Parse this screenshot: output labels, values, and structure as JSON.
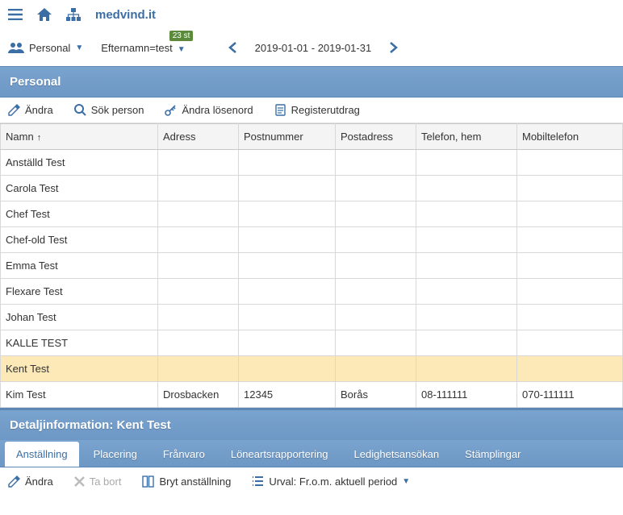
{
  "brand": "medvind.it",
  "toolbar": {
    "personal_label": "Personal",
    "filter_label": "Efternamn=test",
    "badge": "23 st",
    "date_range": "2019-01-01 - 2019-01-31"
  },
  "section_title": "Personal",
  "actions": {
    "edit": "Ändra",
    "search_person": "Sök person",
    "change_password": "Ändra lösenord",
    "register_extract": "Registerutdrag"
  },
  "columns": [
    "Namn",
    "Adress",
    "Postnummer",
    "Postadress",
    "Telefon, hem",
    "Mobiltelefon"
  ],
  "sort_indicator": "↑",
  "rows": [
    {
      "name": "Anställd Test",
      "adress": "",
      "postnr": "",
      "postadr": "",
      "tel": "",
      "mobil": "",
      "selected": false
    },
    {
      "name": "Carola Test",
      "adress": "",
      "postnr": "",
      "postadr": "",
      "tel": "",
      "mobil": "",
      "selected": false
    },
    {
      "name": "Chef Test",
      "adress": "",
      "postnr": "",
      "postadr": "",
      "tel": "",
      "mobil": "",
      "selected": false
    },
    {
      "name": "Chef-old Test",
      "adress": "",
      "postnr": "",
      "postadr": "",
      "tel": "",
      "mobil": "",
      "selected": false
    },
    {
      "name": "Emma Test",
      "adress": "",
      "postnr": "",
      "postadr": "",
      "tel": "",
      "mobil": "",
      "selected": false
    },
    {
      "name": "Flexare Test",
      "adress": "",
      "postnr": "",
      "postadr": "",
      "tel": "",
      "mobil": "",
      "selected": false
    },
    {
      "name": "Johan Test",
      "adress": "",
      "postnr": "",
      "postadr": "",
      "tel": "",
      "mobil": "",
      "selected": false
    },
    {
      "name": "KALLE TEST",
      "adress": "",
      "postnr": "",
      "postadr": "",
      "tel": "",
      "mobil": "",
      "selected": false
    },
    {
      "name": "Kent Test",
      "adress": "",
      "postnr": "",
      "postadr": "",
      "tel": "",
      "mobil": "",
      "selected": true
    },
    {
      "name": "Kim Test",
      "adress": "Drosbacken",
      "postnr": "12345",
      "postadr": "Borås",
      "tel": "08-111111",
      "mobil": "070-111111",
      "selected": false
    }
  ],
  "detail_title": "Detaljinformation: Kent Test",
  "tabs": [
    {
      "label": "Anställning",
      "active": true
    },
    {
      "label": "Placering",
      "active": false
    },
    {
      "label": "Frånvaro",
      "active": false
    },
    {
      "label": "Löneartsrapportering",
      "active": false
    },
    {
      "label": "Ledighetsansökan",
      "active": false
    },
    {
      "label": "Stämplingar",
      "active": false
    }
  ],
  "detail_actions": {
    "edit": "Ändra",
    "delete": "Ta bort",
    "break": "Bryt anställning",
    "selection": "Urval: Fr.o.m. aktuell period"
  }
}
